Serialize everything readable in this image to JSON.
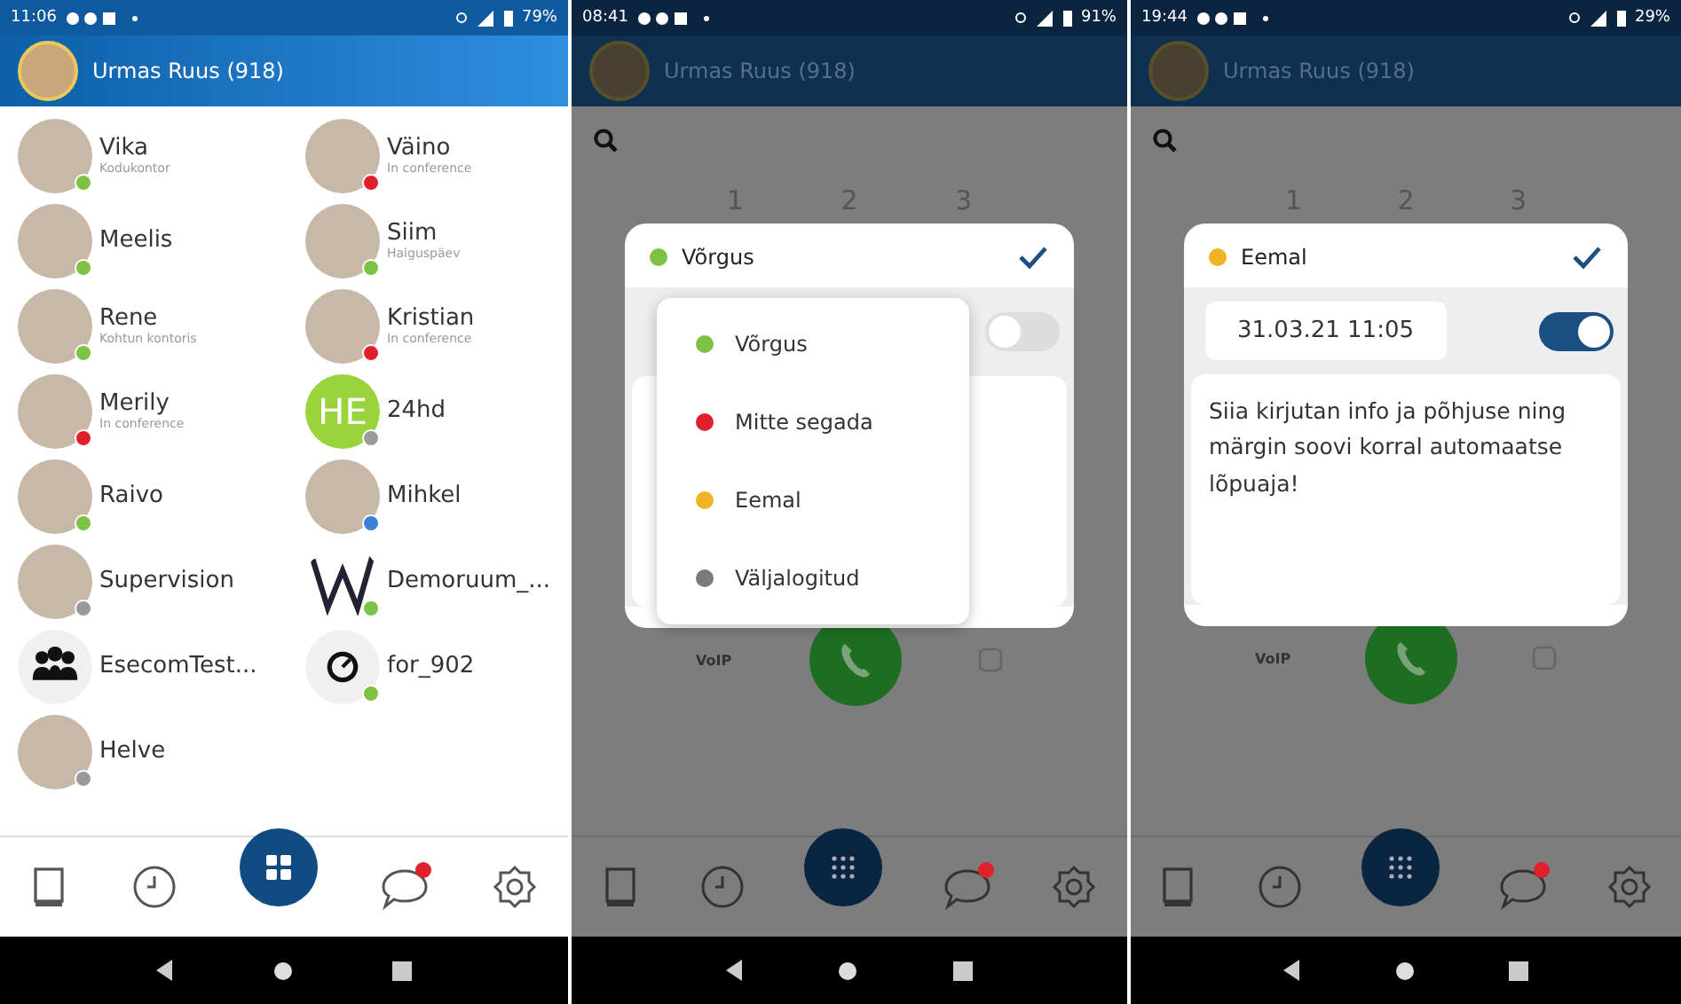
{
  "phones": [
    {
      "kind": "contacts",
      "status_bar": {
        "time": "11:06",
        "battery": "79%"
      },
      "header": {
        "name": "Urmas Ruus (918)"
      },
      "contacts": [
        {
          "name": "Vika",
          "status": "Kodukontor",
          "kind": "photo",
          "color": "#7dc243"
        },
        {
          "name": "Väino",
          "status": "In conference",
          "kind": "photo",
          "color": "#e0202a"
        },
        {
          "name": "Meelis",
          "kind": "photo",
          "color": "#7dc243"
        },
        {
          "name": "Siim",
          "status": "Haiguspäev",
          "kind": "photo",
          "color": "#7dc243"
        },
        {
          "name": "Rene",
          "status": "Kohtun kontoris",
          "kind": "photo",
          "color": "#7dc243"
        },
        {
          "name": "Kristian",
          "status": "In conference",
          "kind": "photo",
          "color": "#e0202a"
        },
        {
          "name": "Merily",
          "status": "In conference",
          "kind": "photo",
          "color": "#e0202a"
        },
        {
          "name": "24hd",
          "kind": "initials",
          "initials": "HE",
          "color": "#9a9a9a"
        },
        {
          "name": "Raivo",
          "kind": "photo",
          "color": "#7dc243"
        },
        {
          "name": "Mihkel",
          "kind": "photo",
          "color": "#3d7fd6"
        },
        {
          "name": "Supervision",
          "kind": "photo",
          "color": "#9a9a9a"
        },
        {
          "name": "Demoruum_...",
          "kind": "logo",
          "color": "#7dc243"
        },
        {
          "name": "EsecomTest...",
          "kind": "group"
        },
        {
          "name": "for_902",
          "kind": "clock",
          "color": "#7dc243"
        },
        {
          "name": "Helve",
          "kind": "photo",
          "color": "#9a9a9a"
        }
      ],
      "nav": {
        "unread": true
      }
    },
    {
      "kind": "status_menu",
      "status_bar": {
        "time": "08:41",
        "battery": "91%"
      },
      "header": {
        "name": "Urmas Ruus (918)"
      },
      "keys": [
        "1",
        "2",
        "3"
      ],
      "voip": "VoIP",
      "dialog": {
        "status": {
          "label": "Võrgus",
          "color": "#7dc243"
        },
        "toggle_on": false,
        "menu": [
          {
            "label": "Võrgus",
            "color": "#7dc243"
          },
          {
            "label": "Mitte segada",
            "color": "#e0202a"
          },
          {
            "label": "Eemal",
            "color": "#f0b323"
          },
          {
            "label": "Väljalogitud",
            "color": "#7a7a7a"
          }
        ]
      },
      "nav": {
        "unread": true
      }
    },
    {
      "kind": "away_note",
      "status_bar": {
        "time": "19:44",
        "battery": "29%"
      },
      "header": {
        "name": "Urmas Ruus (918)"
      },
      "keys": [
        "1",
        "2",
        "3"
      ],
      "voip": "VoIP",
      "dialog": {
        "status": {
          "label": "Eemal",
          "color": "#f0b323"
        },
        "date": "31.03.21 11:05",
        "toggle_on": true,
        "note": "Siia kirjutan info ja põhjuse ning märgin soovi korral automaatse lõpuaja!"
      },
      "nav": {
        "unread": true
      }
    }
  ]
}
